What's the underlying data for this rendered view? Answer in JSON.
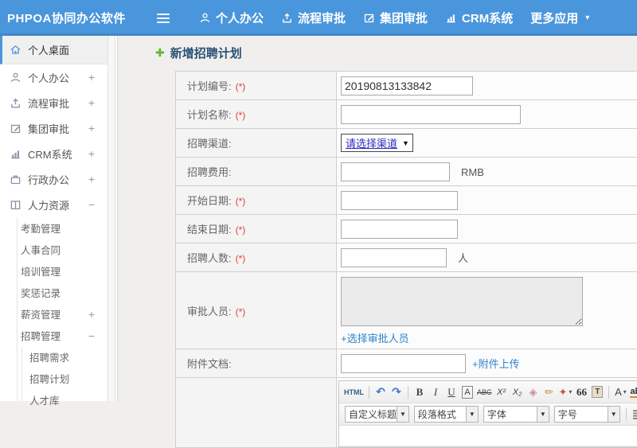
{
  "app": {
    "logo_text": "PHPOA协同办公软件",
    "accent_color": "#4a96dc",
    "link_color": "#2f83cd",
    "required_color": "#e23c3c"
  },
  "topnav": {
    "items": [
      {
        "label": "个人办公",
        "icon": "user-icon"
      },
      {
        "label": "流程审批",
        "icon": "flow-icon"
      },
      {
        "label": "集团审批",
        "icon": "edit-icon"
      },
      {
        "label": "CRM系统",
        "icon": "chart-icon"
      },
      {
        "label": "更多应用",
        "icon": "caret-down-icon",
        "caret": "▾"
      }
    ]
  },
  "sidebar": {
    "items": [
      {
        "label": "个人桌面",
        "expander": ""
      },
      {
        "label": "个人办公",
        "expander": "+"
      },
      {
        "label": "流程审批",
        "expander": "+"
      },
      {
        "label": "集团审批",
        "expander": "+"
      },
      {
        "label": "CRM系统",
        "expander": "+"
      },
      {
        "label": "行政办公",
        "expander": "+"
      },
      {
        "label": "人力资源",
        "expander": "−"
      }
    ],
    "hr_children": [
      {
        "label": "考勤管理",
        "expander": ""
      },
      {
        "label": "人事合同",
        "expander": ""
      },
      {
        "label": "培训管理",
        "expander": ""
      },
      {
        "label": "奖惩记录",
        "expander": ""
      },
      {
        "label": "薪资管理",
        "expander": "+"
      },
      {
        "label": "招聘管理",
        "expander": "−"
      }
    ],
    "recruit_children": [
      {
        "label": "招聘需求"
      },
      {
        "label": "招聘计划"
      },
      {
        "label": "人才库"
      }
    ]
  },
  "main": {
    "title_icon": "✚",
    "page_title": "新增招聘计划",
    "required_mark": "(*)",
    "form": {
      "rows": {
        "plan_no": {
          "label": "计划编号:",
          "value": "20190813133842"
        },
        "plan_name": {
          "label": "计划名称:",
          "value": ""
        },
        "channel": {
          "label": "招聘渠道:",
          "select_value": "请选择渠道",
          "caret": "▼"
        },
        "fee": {
          "label": "招聘费用:",
          "value": "",
          "suffix": "RMB"
        },
        "start_date": {
          "label": "开始日期:",
          "value": ""
        },
        "end_date": {
          "label": "结束日期:",
          "value": ""
        },
        "headcount": {
          "label": "招聘人数:",
          "value": "",
          "suffix": "人"
        },
        "approvers": {
          "label": "审批人员:",
          "link": "+选择审批人员"
        },
        "attachment": {
          "label": "附件文档:",
          "value": "",
          "link": "+附件上传"
        }
      }
    },
    "editor": {
      "buttons": {
        "html": "HTML",
        "undo": "↶",
        "redo": "↷",
        "bold": "B",
        "italic": "I",
        "underline": "U",
        "boxed_a": "A",
        "strike": "ABC",
        "sup": "X²",
        "sub": "X₂",
        "eraser": "◈",
        "brush": "✏",
        "palette": "✦",
        "palette_caret": "▾",
        "quote": "66",
        "paste": "T",
        "fontcolor": "A",
        "fontcolor_caret": "▾",
        "highlight": "ab",
        "highlight_caret": "▾"
      },
      "dropdowns": [
        {
          "label": "自定义标题",
          "caret": "▼"
        },
        {
          "label": "段落格式",
          "caret": "▼"
        },
        {
          "label": "字体",
          "caret": "▼"
        },
        {
          "label": "字号",
          "caret": "▼"
        }
      ]
    }
  }
}
